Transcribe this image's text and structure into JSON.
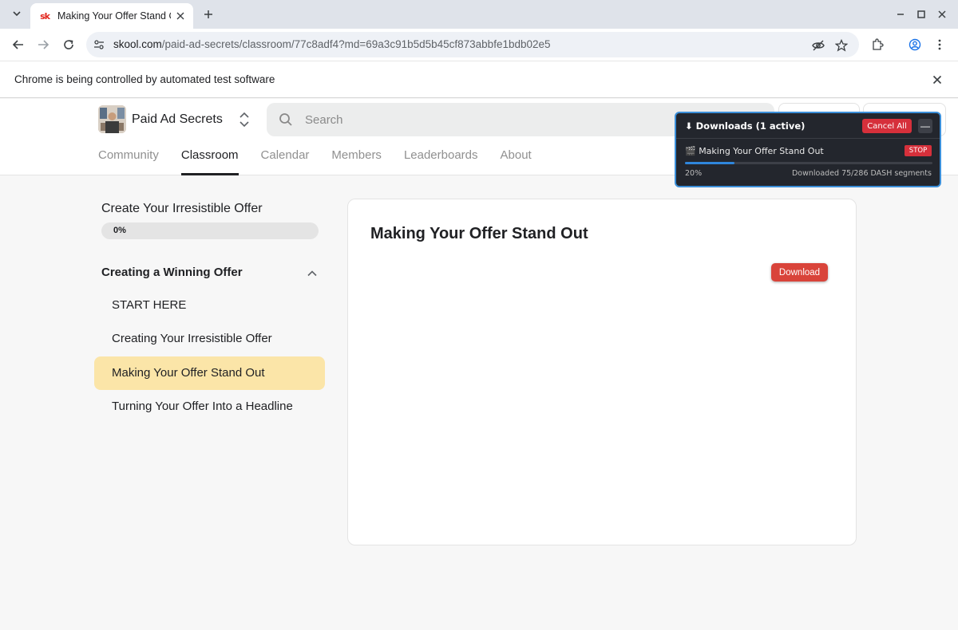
{
  "browser": {
    "tab": {
      "title": "Making Your Offer Stand Out",
      "favicon_text": "sk",
      "favicon_color": "#e2231a"
    },
    "url": {
      "host": "skool.com",
      "path": "/paid-ad-secrets/classroom/77c8adf4?md=69a3c91b5d5b45cf873abbfe1bdb02e5"
    },
    "infobar": {
      "text": "Chrome is being controlled by automated test software"
    },
    "icons": [
      "chevron-down-icon",
      "close-icon",
      "plus-icon",
      "minimize-icon",
      "maximize-icon",
      "back-icon",
      "forward-icon",
      "reload-icon",
      "site-settings-icon",
      "eye-off-icon",
      "star-icon",
      "extensions-icon",
      "profile-icon",
      "more-vert-icon"
    ]
  },
  "header": {
    "group_name": "Paid Ad Secrets",
    "search": {
      "placeholder": "Search"
    },
    "nav": [
      {
        "label": "Community",
        "active": false
      },
      {
        "label": "Classroom",
        "active": true
      },
      {
        "label": "Calendar",
        "active": false
      },
      {
        "label": "Members",
        "active": false
      },
      {
        "label": "Leaderboards",
        "active": false
      },
      {
        "label": "About",
        "active": false
      }
    ]
  },
  "sidebar": {
    "course_title": "Create Your Irresistible Offer",
    "progress": {
      "label": "0%",
      "value": 0
    },
    "section": {
      "title": "Creating a Winning Offer",
      "expanded": true
    },
    "lessons": [
      {
        "label": "START HERE",
        "active": false
      },
      {
        "label": "Creating Your Irresistible Offer",
        "active": false
      },
      {
        "label": "Making Your Offer Stand Out",
        "active": true
      },
      {
        "label": "Turning Your Offer Into a Headline",
        "active": false
      }
    ]
  },
  "content": {
    "lesson_title": "Making Your Offer Stand Out",
    "download_label": "Download"
  },
  "downloads": {
    "title": "⬇ Downloads (1 active)",
    "cancel_all_label": "Cancel All",
    "minimize_label": "—",
    "item": {
      "name": "🎬 Making Your Offer Stand Out",
      "stop_label": "STOP",
      "percent_label": "20%",
      "progress": 0.2,
      "status": "Downloaded 75/286 DASH segments"
    }
  },
  "colors": {
    "active_lesson_bg": "#fbe5a8",
    "download_button": "#d9443a",
    "panel_bg": "#23262d",
    "panel_border": "#3b8fd9",
    "danger": "#d6303b",
    "progress_accent": "#2f86dc"
  }
}
